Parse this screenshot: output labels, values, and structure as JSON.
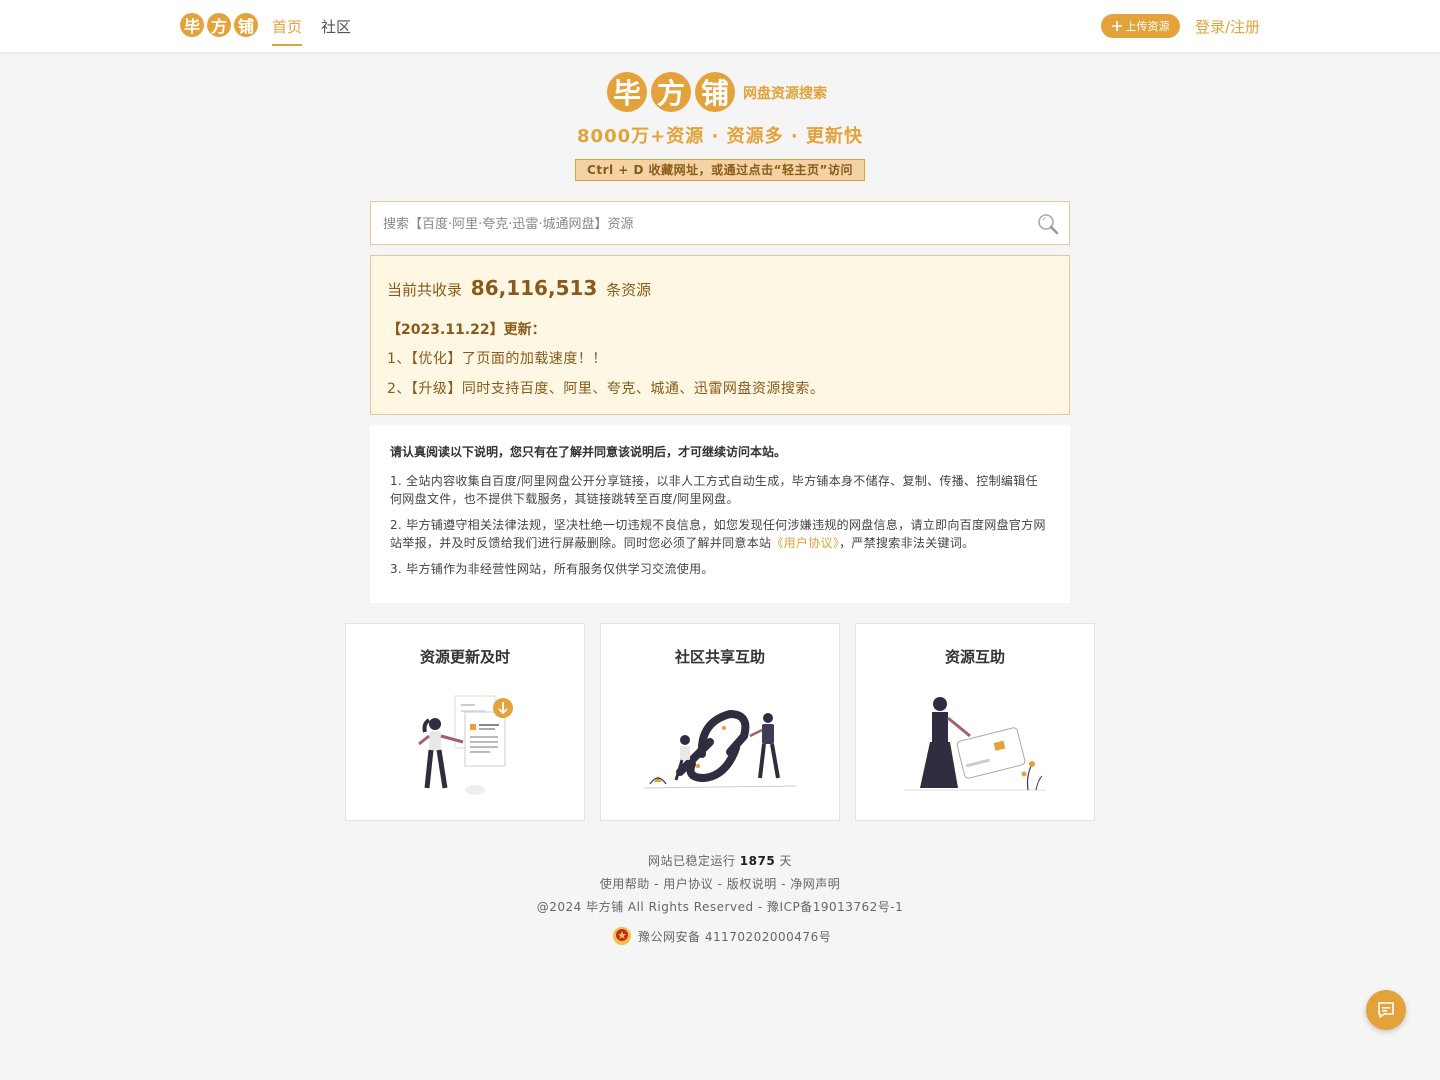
{
  "nav": {
    "logo_chars": [
      "毕",
      "方",
      "铺"
    ],
    "tabs": [
      {
        "label": "首页",
        "active": true
      },
      {
        "label": "社区",
        "active": false
      }
    ],
    "upload_label": "上传资源",
    "login_label": "登录/注册"
  },
  "hero": {
    "logo_chars": [
      "毕",
      "方",
      "铺"
    ],
    "tagline": "网盘资源搜索",
    "slogan": "8000万+资源 · 资源多 · 更新快",
    "tip": "Ctrl + D 收藏网址，或通过点击“轻主页”访问"
  },
  "search": {
    "placeholder": "搜索【百度·阿里·夸克·迅雷·城通网盘】资源"
  },
  "stats": {
    "prefix": "当前共收录",
    "count": "86,116,513",
    "suffix": "条资源",
    "update_title": "【2023.11.22】更新：",
    "updates": [
      "1、【优化】了页面的加载速度！！",
      "2、【升级】同时支持百度、阿里、夸克、城通、迅雷网盘资源搜索。"
    ]
  },
  "disclaimer": {
    "heading": "请认真阅读以下说明，您只有在了解并同意该说明后，才可继续访问本站。",
    "p1": "1. 全站内容收集自百度/阿里网盘公开分享链接，以非人工方式自动生成，毕方铺本身不储存、复制、传播、控制编辑任何网盘文件，也不提供下载服务，其链接跳转至百度/阿里网盘。",
    "p2_before": "2. 毕方铺遵守相关法律法规，坚决杜绝一切违规不良信息，如您发现任何涉嫌违规的网盘信息，请立即向百度网盘官方网站举报，并及时反馈给我们进行屏蔽删除。同时您必须了解并同意本站",
    "p2_link": "《用户协议》",
    "p2_after": "，严禁搜索非法关键词。",
    "p3": "3. 毕方铺作为非经营性网站，所有服务仅供学习交流使用。"
  },
  "cards": [
    {
      "title": "资源更新及时"
    },
    {
      "title": "社区共享互助"
    },
    {
      "title": "资源互助"
    }
  ],
  "footer": {
    "uptime_prefix": "网站已稳定运行",
    "uptime_days": "1875",
    "uptime_suffix": "天",
    "links": [
      "使用帮助",
      "用户协议",
      "版权说明",
      "净网声明"
    ],
    "copyright": "@2024 毕方铺 All Rights Reserved - 豫ICP备19013762号-1",
    "police": "豫公网安备 41170202000476号"
  },
  "colors": {
    "accent": "#e4a23b",
    "panel_bg": "#fdf7e3",
    "page_bg": "#f5f5f5"
  },
  "icons": [
    "plus-icon",
    "search-icon",
    "police-badge-icon",
    "chat-icon"
  ]
}
